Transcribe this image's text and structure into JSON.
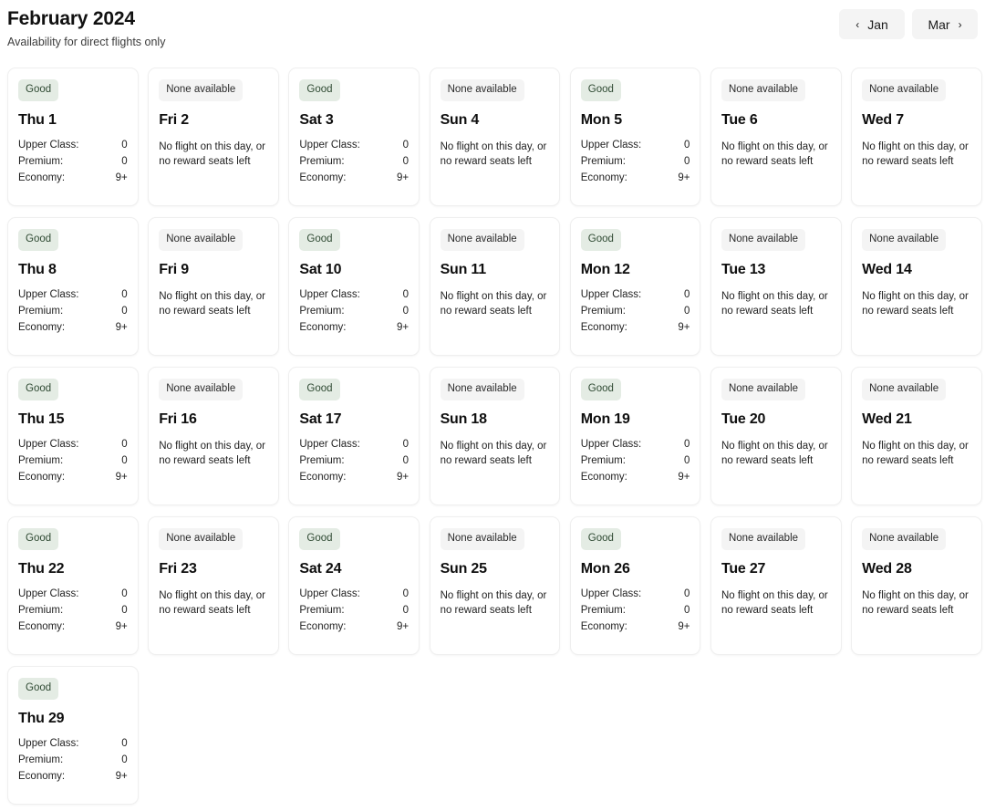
{
  "header": {
    "title": "February 2024",
    "subtitle": "Availability for direct flights only",
    "prev_label": "Jan",
    "next_label": "Mar",
    "prev_icon": "chevron-left-icon",
    "next_icon": "chevron-right-icon",
    "prev_chevron": "‹",
    "next_chevron": "›"
  },
  "labels": {
    "status_good": "Good",
    "status_none": "None available",
    "empty_note": "No flight on this day, or no reward seats left",
    "class_upper": "Upper Class:",
    "class_premium": "Premium:",
    "class_economy": "Economy:"
  },
  "colors": {
    "badge_good_bg": "#e4ece4",
    "badge_good_text": "#2f4a33",
    "badge_none_bg": "#f4f4f4",
    "badge_none_text": "#2b2b2b",
    "card_bg": "#ffffff",
    "card_border": "#efefef",
    "nav_button_bg": "#f4f4f4",
    "page_bg": "#ffffff",
    "title_text": "#111111"
  },
  "days": [
    {
      "label": "Thu 1",
      "status": "Good",
      "has_availability": true,
      "upper_class": "0",
      "premium": "0",
      "economy": "9+"
    },
    {
      "label": "Fri 2",
      "status": "None available",
      "has_availability": false,
      "note": "No flight on this day, or no reward seats left"
    },
    {
      "label": "Sat 3",
      "status": "Good",
      "has_availability": true,
      "upper_class": "0",
      "premium": "0",
      "economy": "9+"
    },
    {
      "label": "Sun 4",
      "status": "None available",
      "has_availability": false,
      "note": "No flight on this day, or no reward seats left"
    },
    {
      "label": "Mon 5",
      "status": "Good",
      "has_availability": true,
      "upper_class": "0",
      "premium": "0",
      "economy": "9+"
    },
    {
      "label": "Tue 6",
      "status": "None available",
      "has_availability": false,
      "note": "No flight on this day, or no reward seats left"
    },
    {
      "label": "Wed 7",
      "status": "None available",
      "has_availability": false,
      "note": "No flight on this day, or no reward seats left"
    },
    {
      "label": "Thu 8",
      "status": "Good",
      "has_availability": true,
      "upper_class": "0",
      "premium": "0",
      "economy": "9+"
    },
    {
      "label": "Fri 9",
      "status": "None available",
      "has_availability": false,
      "note": "No flight on this day, or no reward seats left"
    },
    {
      "label": "Sat 10",
      "status": "Good",
      "has_availability": true,
      "upper_class": "0",
      "premium": "0",
      "economy": "9+"
    },
    {
      "label": "Sun 11",
      "status": "None available",
      "has_availability": false,
      "note": "No flight on this day, or no reward seats left"
    },
    {
      "label": "Mon 12",
      "status": "Good",
      "has_availability": true,
      "upper_class": "0",
      "premium": "0",
      "economy": "9+"
    },
    {
      "label": "Tue 13",
      "status": "None available",
      "has_availability": false,
      "note": "No flight on this day, or no reward seats left"
    },
    {
      "label": "Wed 14",
      "status": "None available",
      "has_availability": false,
      "note": "No flight on this day, or no reward seats left"
    },
    {
      "label": "Thu 15",
      "status": "Good",
      "has_availability": true,
      "upper_class": "0",
      "premium": "0",
      "economy": "9+"
    },
    {
      "label": "Fri 16",
      "status": "None available",
      "has_availability": false,
      "note": "No flight on this day, or no reward seats left"
    },
    {
      "label": "Sat 17",
      "status": "Good",
      "has_availability": true,
      "upper_class": "0",
      "premium": "0",
      "economy": "9+"
    },
    {
      "label": "Sun 18",
      "status": "None available",
      "has_availability": false,
      "note": "No flight on this day, or no reward seats left"
    },
    {
      "label": "Mon 19",
      "status": "Good",
      "has_availability": true,
      "upper_class": "0",
      "premium": "0",
      "economy": "9+"
    },
    {
      "label": "Tue 20",
      "status": "None available",
      "has_availability": false,
      "note": "No flight on this day, or no reward seats left"
    },
    {
      "label": "Wed 21",
      "status": "None available",
      "has_availability": false,
      "note": "No flight on this day, or no reward seats left"
    },
    {
      "label": "Thu 22",
      "status": "Good",
      "has_availability": true,
      "upper_class": "0",
      "premium": "0",
      "economy": "9+"
    },
    {
      "label": "Fri 23",
      "status": "None available",
      "has_availability": false,
      "note": "No flight on this day, or no reward seats left"
    },
    {
      "label": "Sat 24",
      "status": "Good",
      "has_availability": true,
      "upper_class": "0",
      "premium": "0",
      "economy": "9+"
    },
    {
      "label": "Sun 25",
      "status": "None available",
      "has_availability": false,
      "note": "No flight on this day, or no reward seats left"
    },
    {
      "label": "Mon 26",
      "status": "Good",
      "has_availability": true,
      "upper_class": "0",
      "premium": "0",
      "economy": "9+"
    },
    {
      "label": "Tue 27",
      "status": "None available",
      "has_availability": false,
      "note": "No flight on this day, or no reward seats left"
    },
    {
      "label": "Wed 28",
      "status": "None available",
      "has_availability": false,
      "note": "No flight on this day, or no reward seats left"
    },
    {
      "label": "Thu 29",
      "status": "Good",
      "has_availability": true,
      "upper_class": "0",
      "premium": "0",
      "economy": "9+"
    }
  ]
}
